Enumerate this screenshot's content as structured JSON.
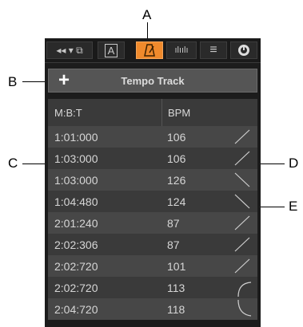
{
  "callouts": {
    "a": "A",
    "b": "B",
    "c": "C",
    "d": "D",
    "e": "E"
  },
  "toolbar": {
    "buttons": [
      {
        "icon": "rewind-dropdown-icon",
        "label": "◂◂ ▾ ⧉"
      },
      {
        "icon": "text-a-icon",
        "label": "A"
      },
      {
        "icon": "metronome-icon",
        "label": ""
      },
      {
        "icon": "audio-waveform-icon",
        "label": "ılıılı"
      },
      {
        "icon": "menu-lines-icon",
        "label": "≡"
      },
      {
        "icon": "power-icon",
        "label": ""
      }
    ],
    "active_color": "#f08a2c"
  },
  "panel": {
    "add_label": "+",
    "title": "Tempo Track"
  },
  "columns": {
    "mbt": "M:B:T",
    "bpm": "BPM"
  },
  "rows": [
    {
      "time": "1:01:000",
      "bpm": "106",
      "curve": "line-up"
    },
    {
      "time": "1:03:000",
      "bpm": "106",
      "curve": "line-up"
    },
    {
      "time": "1:03:000",
      "bpm": "126",
      "curve": "line-down"
    },
    {
      "time": "1:04:480",
      "bpm": "124",
      "curve": "line-down"
    },
    {
      "time": "2:01:240",
      "bpm": "87",
      "curve": "line-up"
    },
    {
      "time": "2:02:306",
      "bpm": "87",
      "curve": "line-up"
    },
    {
      "time": "2:02:720",
      "bpm": "101",
      "curve": "line-up"
    },
    {
      "time": "2:02:720",
      "bpm": "113",
      "curve": "curve-up"
    },
    {
      "time": "2:04:720",
      "bpm": "118",
      "curve": "curve-down"
    }
  ]
}
